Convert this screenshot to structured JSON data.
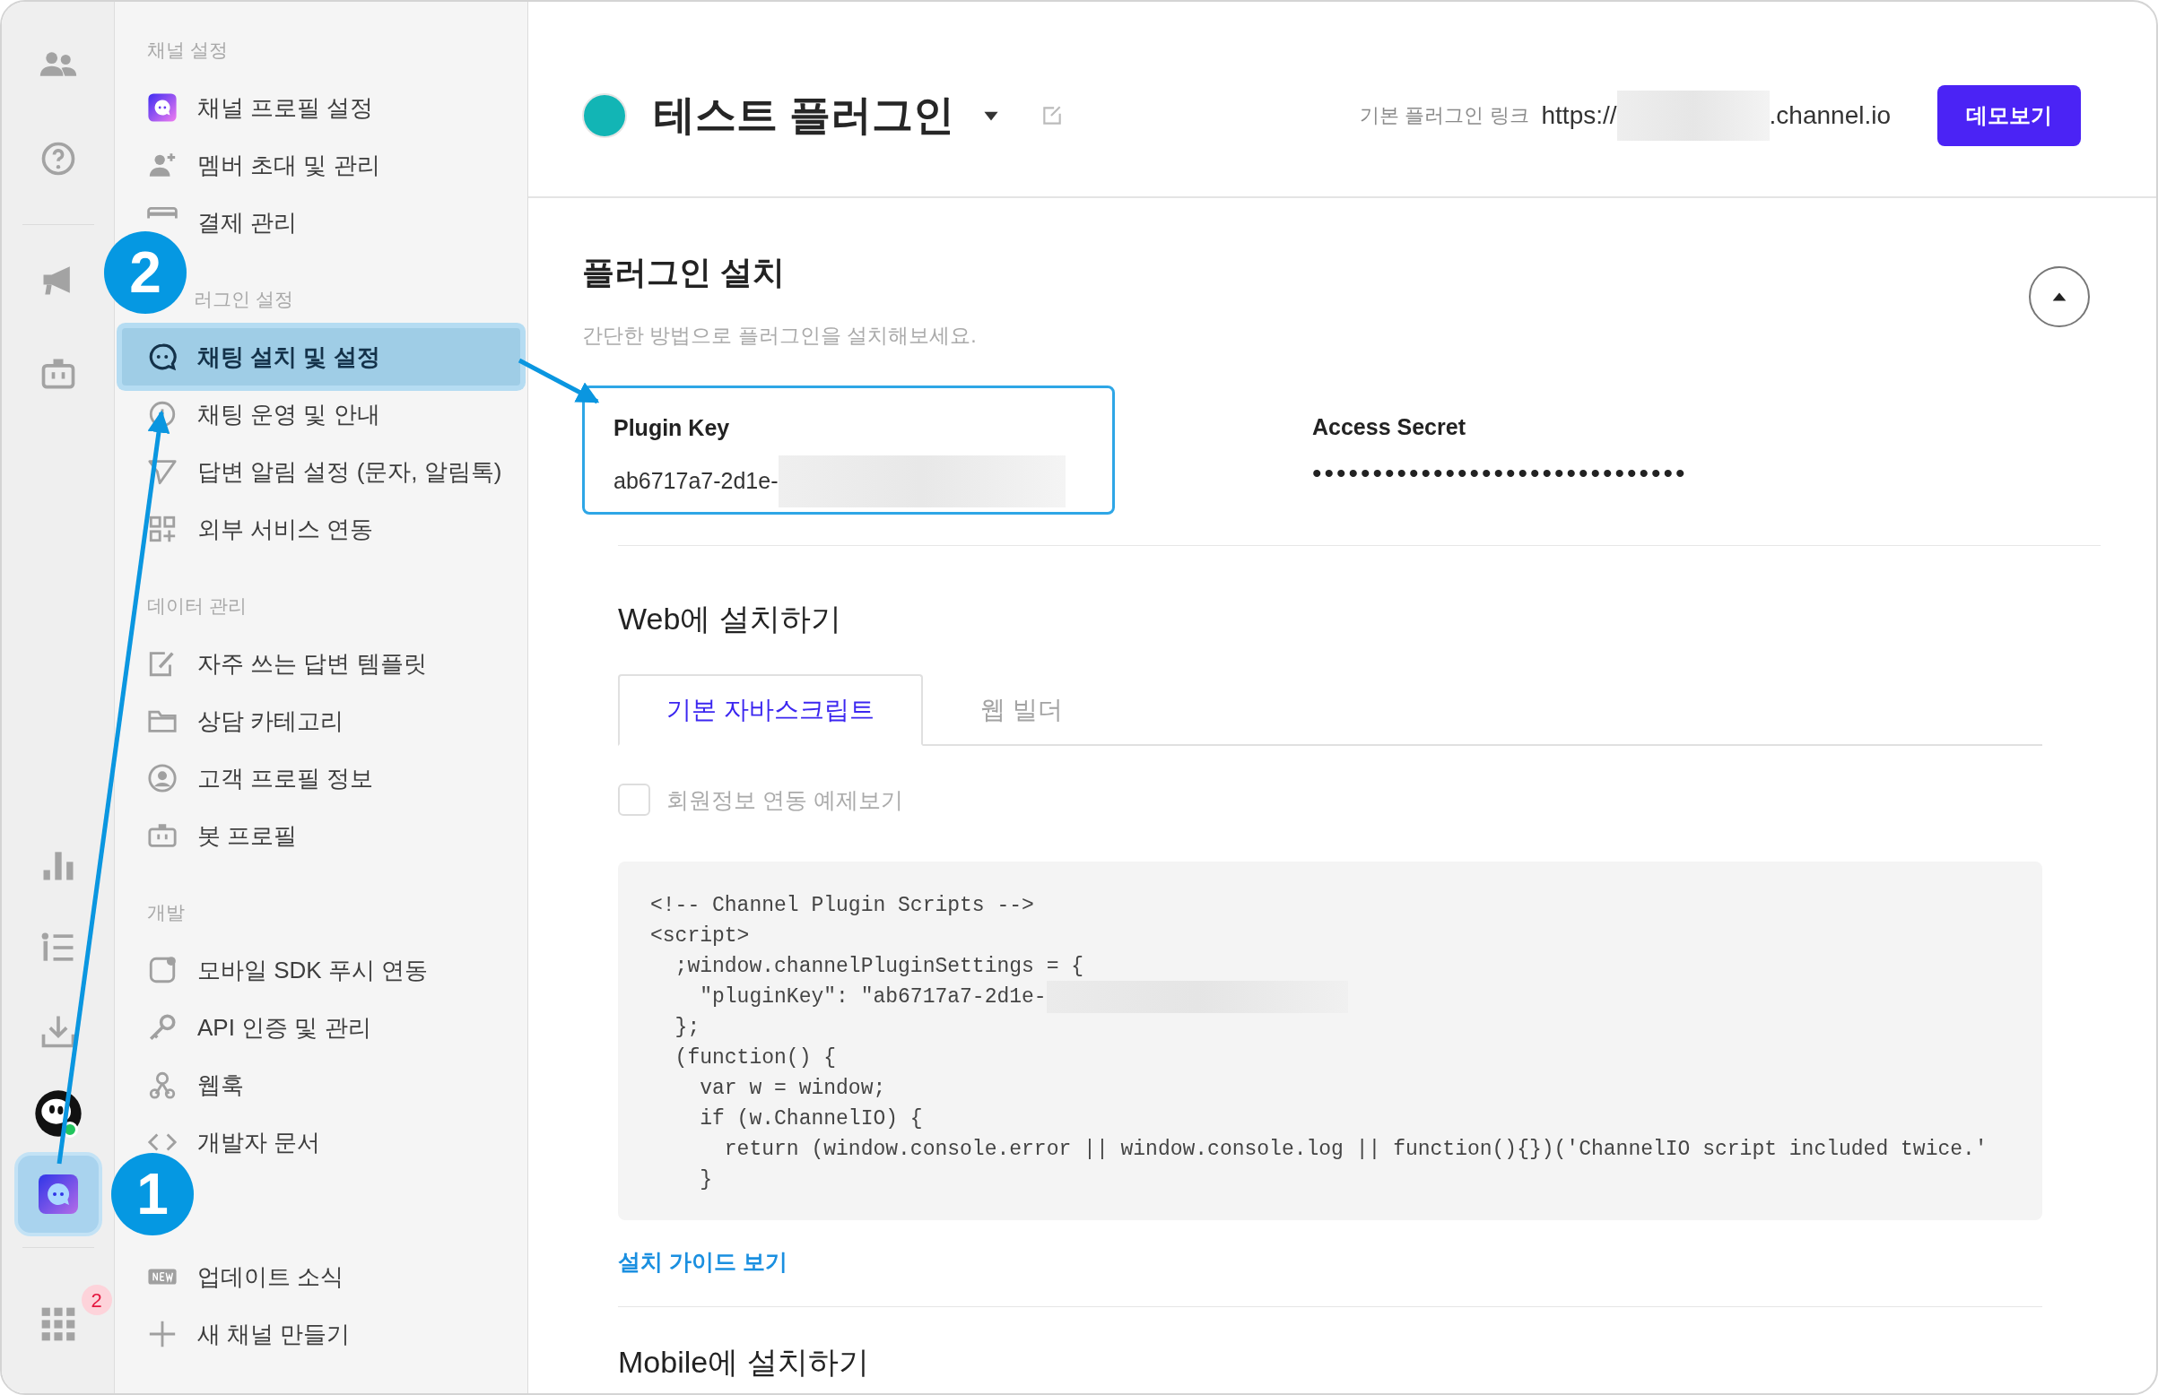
{
  "rail": {
    "items": [
      {
        "selected": false
      },
      {
        "selected": false
      },
      {
        "selected": false
      },
      {
        "selected": false
      },
      {
        "selected": false
      },
      {
        "selected": false
      },
      {
        "selected": false
      },
      {
        "selected": false,
        "online": true
      },
      {
        "selected": true
      },
      {
        "selected": false,
        "badge": "2"
      }
    ]
  },
  "sidebar": {
    "sections": [
      {
        "label": "채널 설정",
        "items": [
          {
            "label": "채널 프로필 설정",
            "selected": false
          },
          {
            "label": "멤버 초대 및 관리",
            "selected": false
          },
          {
            "label": "결제 관리",
            "selected": false
          }
        ]
      },
      {
        "label": "러그인 설정",
        "items": [
          {
            "label": "채팅 설치 및 설정",
            "selected": true
          },
          {
            "label": "채팅 운영 및 안내",
            "selected": false
          },
          {
            "label": "답변 알림 설정 (문자, 알림톡)",
            "selected": false
          },
          {
            "label": "외부 서비스 연동",
            "selected": false
          }
        ]
      },
      {
        "label": "데이터 관리",
        "items": [
          {
            "label": "자주 쓰는 답변 템플릿",
            "selected": false
          },
          {
            "label": "상담 카테고리",
            "selected": false
          },
          {
            "label": "고객 프로필 정보",
            "selected": false
          },
          {
            "label": "봇 프로필",
            "selected": false
          }
        ]
      },
      {
        "label": "개발",
        "items": [
          {
            "label": "모바일 SDK 푸시 연동",
            "selected": false
          },
          {
            "label": "API 인증 및 관리",
            "selected": false
          },
          {
            "label": "웹훅",
            "selected": false
          },
          {
            "label": "개발자 문서",
            "selected": false
          }
        ]
      },
      {
        "items": [
          {
            "label": "업데이트 소식",
            "selected": false
          },
          {
            "label": "새 채널 만들기",
            "selected": false
          }
        ]
      }
    ]
  },
  "header": {
    "color": "#12b5b5",
    "title": "테스트 플러그인",
    "link_label": "기본 플러그인 링크",
    "link_prefix": "https://",
    "link_masked": true,
    "link_suffix": ".channel.io",
    "demo_button": "데모보기"
  },
  "install": {
    "title": "플러그인 설치",
    "subtitle": "간단한 방법으로 플러그인을 설치해보세요.",
    "expanded": true,
    "plugin_key": {
      "label": "Plugin Key",
      "value": "ab6717a7-2d1e-",
      "masked": true,
      "selected": true
    },
    "access_secret": {
      "label": "Access Secret",
      "value": "•••••••••••••••••••••••••••••••"
    },
    "web_title": "Web에 설치하기",
    "tabs": [
      {
        "label": "기본 자바스크립트",
        "selected": true
      },
      {
        "label": "웹 빌더",
        "selected": false
      }
    ],
    "checkbox": {
      "label": "회원정보 연동 예제보기",
      "checked": false
    },
    "code": [
      {
        "text": "<!-- Channel Plugin Scripts -->"
      },
      {
        "text": "<script>"
      },
      {
        "text": "  ;window.channelPluginSettings = {"
      },
      {
        "text": "    \"pluginKey\": \"ab6717a7-2d1e-",
        "masked": true
      },
      {
        "text": "  };"
      },
      {
        "text": "  (function() {"
      },
      {
        "text": "    var w = window;"
      },
      {
        "text": "    if (w.ChannelIO) {"
      },
      {
        "text": "      return (window.console.error || window.console.log || function(){})('ChannelIO script included twice.'"
      },
      {
        "text": "    }"
      }
    ],
    "guide_link": "설치 가이드 보기",
    "mobile_title": "Mobile에 설치하기"
  },
  "annotations": {
    "callouts": [
      {
        "label": "2"
      },
      {
        "label": "1"
      }
    ]
  }
}
